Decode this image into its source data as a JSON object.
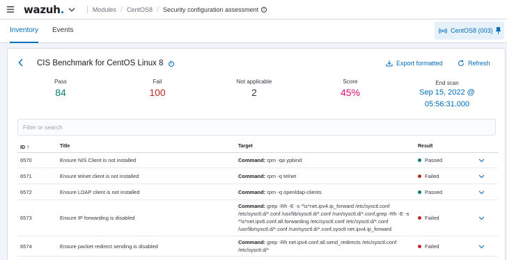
{
  "header": {
    "logo_text": "wazuh",
    "logo_dot": ".",
    "breadcrumb": [
      "Modules",
      "CentOS8",
      "Security configuration assessment"
    ]
  },
  "tabs": [
    "Inventory",
    "Events"
  ],
  "agent": {
    "label": "CentOS8 (003)"
  },
  "panel": {
    "title": "CIS Benchmark for CentOS Linux 8",
    "export_label": "Export formatted",
    "refresh_label": "Refresh"
  },
  "stats": {
    "pass": {
      "label": "Pass",
      "value": "84"
    },
    "fail": {
      "label": "Fail",
      "value": "100"
    },
    "na": {
      "label": "Not applicable",
      "value": "2"
    },
    "score": {
      "label": "Score",
      "value": "45%"
    },
    "end_scan": {
      "label": "End scan",
      "line1": "Sep 15, 2022 @",
      "line2": "05:56:31.000"
    }
  },
  "filter": {
    "placeholder": "Filter or search"
  },
  "table": {
    "columns": {
      "id": "ID",
      "title": "Title",
      "target": "Target",
      "result": "Result"
    },
    "command_label": "Command:",
    "rows": [
      {
        "id": "6570",
        "title": "Ensure NIS Client is not installed",
        "command": "rpm -qa ypbind",
        "result": "Passed"
      },
      {
        "id": "6571",
        "title": "Ensure telnet client is not installed",
        "command": "rpm -q telnet",
        "result": "Failed"
      },
      {
        "id": "6572",
        "title": "Ensure LDAP client is not installed",
        "command": "rpm -q openldap-clients",
        "result": "Passed"
      },
      {
        "id": "6573",
        "title": "Ensure IP forwarding is disabled",
        "command": "grep -Rh -E -s ^\\s*net.ipv4.ip_forward /etc/sysctl.conf /etc/sysctl.d/*.conf /usr/lib/sysctl.d/*.conf /run/sysctl.d/*.conf,grep -Rh -E -s ^\\s*net.ipv6.conf.all.forwarding /etc/sysctl.conf /etc/sysctl.d/*.conf /usr/lib/sysctl.d/*.conf /run/sysctl.d/*.conf,sysctl net.ipv4.ip_forward",
        "result": "Failed"
      },
      {
        "id": "6574",
        "title": "Ensure packet redirect sending is disabled",
        "command": "grep -Rh net.ipv4.conf.all.send_redirects /etc/sysctl.conf /etc/sysctl.d/*",
        "result": "Failed"
      }
    ]
  },
  "colors": {
    "primary": "#006bb8",
    "pass": "#017d73",
    "fail": "#bd271e",
    "score": "#dd0a73",
    "na": "#343741"
  }
}
